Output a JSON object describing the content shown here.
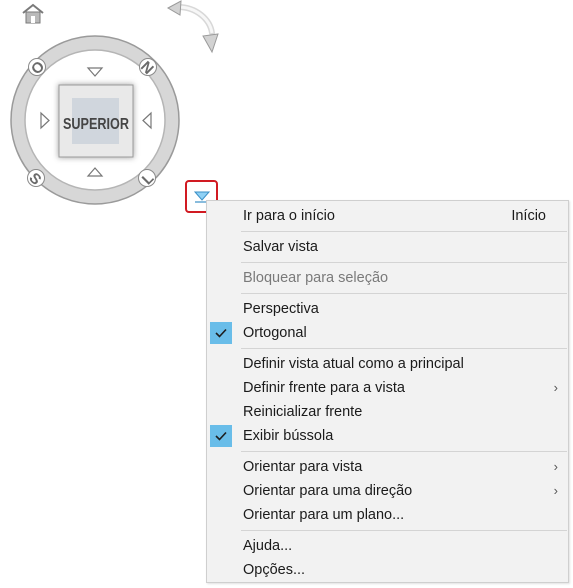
{
  "viewcube": {
    "face_label": "SUPERIOR",
    "compass": {
      "north": "N",
      "south": "S",
      "east": "L",
      "west": "O"
    },
    "icons": {
      "home": "home-icon",
      "rotate": "rotate-arrow-icon",
      "menu": "chevron-down-icon"
    }
  },
  "menu": {
    "groups": [
      {
        "items": [
          {
            "label": "Ir para o início",
            "shortcut": "Início"
          }
        ]
      },
      {
        "items": [
          {
            "label": "Salvar vista"
          }
        ]
      },
      {
        "items": [
          {
            "label": "Bloquear para seleção",
            "disabled": true
          }
        ]
      },
      {
        "items": [
          {
            "label": "Perspectiva"
          },
          {
            "label": "Ortogonal",
            "checked": true
          }
        ]
      },
      {
        "items": [
          {
            "label": "Definir vista atual como a principal"
          },
          {
            "label": "Definir frente para a vista",
            "submenu": true
          },
          {
            "label": "Reinicializar frente"
          },
          {
            "label": "Exibir bússola",
            "checked": true
          }
        ]
      },
      {
        "items": [
          {
            "label": "Orientar para vista",
            "submenu": true
          },
          {
            "label": "Orientar para uma direção",
            "submenu": true
          },
          {
            "label": "Orientar para um plano..."
          }
        ]
      },
      {
        "items": [
          {
            "label": "Ajuda..."
          },
          {
            "label": "Opções..."
          }
        ]
      }
    ]
  },
  "colors": {
    "menu_background": "#f2f2f2",
    "check_highlight": "#69bde9",
    "menu_button_border": "#d11a22",
    "cube_face": "#d0d6dd",
    "compass_ring": "#d7d7d7"
  }
}
